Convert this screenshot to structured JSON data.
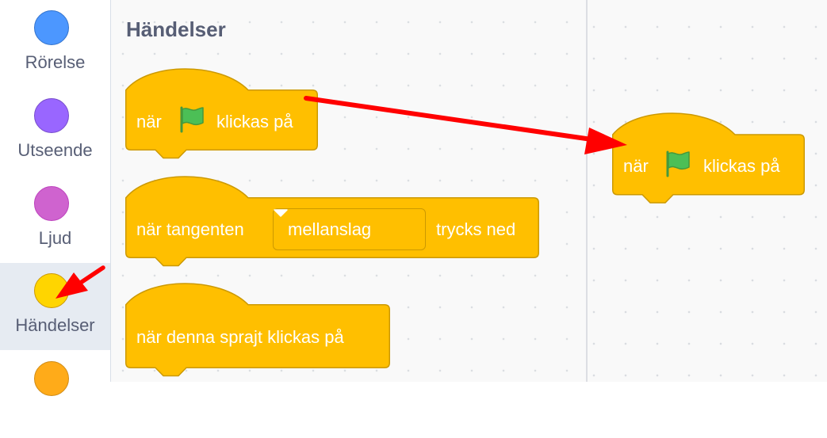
{
  "categories": [
    {
      "label": "Rörelse",
      "color": "#4c97ff",
      "border": "#3373cc",
      "selected": false
    },
    {
      "label": "Utseende",
      "color": "#9966ff",
      "border": "#774dcb",
      "selected": false
    },
    {
      "label": "Ljud",
      "color": "#cf63cf",
      "border": "#bd42bd",
      "selected": false
    },
    {
      "label": "Händelser",
      "color": "#ffd500",
      "border": "#cc9900",
      "selected": true
    },
    {
      "label": "",
      "color": "#ffab19",
      "border": "#cf8b17",
      "selected": false
    }
  ],
  "palette": {
    "title": "Händelser",
    "blocks": {
      "flag_clicked": {
        "before": "när",
        "after": "klickas på"
      },
      "key_pressed": {
        "before": "när tangenten",
        "dropdown": "mellanslag",
        "after": "trycks ned"
      },
      "sprite_clicked": {
        "text": "när denna sprajt klickas på"
      }
    }
  },
  "workspace": {
    "block": {
      "before": "när",
      "after": "klickas på"
    }
  },
  "colors": {
    "event_block": "#ffbf00",
    "event_border": "#cc9900",
    "flag": "#4cbf56",
    "arrow": "#ff0000"
  }
}
